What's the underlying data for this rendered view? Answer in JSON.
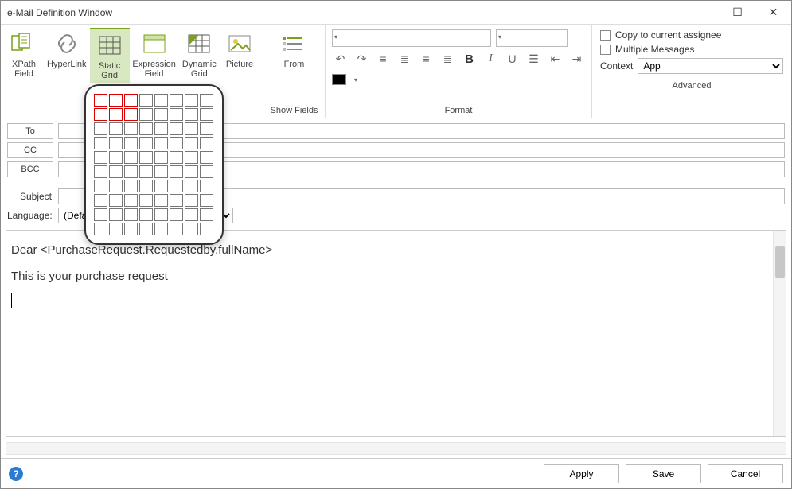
{
  "window": {
    "title": "e-Mail Definition Window"
  },
  "ribbon": {
    "group1": {
      "xpath_field": "XPath\nField",
      "hyperlink": "HyperLink",
      "static_grid": "Static\nGrid",
      "expression_field": "Expression\nField",
      "dynamic_grid": "Dynamic\nGrid",
      "picture": "Picture"
    },
    "show_fields": {
      "label": "Show Fields",
      "from": "From"
    },
    "format": {
      "label": "Format"
    },
    "advanced": {
      "label": "Advanced",
      "copy_assignee": "Copy to current assignee",
      "multiple_messages": "Multiple Messages",
      "context_label": "Context",
      "context_value": "App"
    }
  },
  "fields": {
    "to": "To",
    "cc": "CC",
    "bcc": "BCC",
    "subject": "Subject",
    "language": "Language:",
    "language_value": "(Default)"
  },
  "editor": {
    "line1": "Dear <PurchaseRequest.Requestedby.fullName>",
    "line2": "This is your purchase request"
  },
  "grid_popup": {
    "hint": "2x3",
    "rows": 10,
    "cols": 8,
    "sel_rows": 2,
    "sel_cols": 3
  },
  "footer": {
    "apply": "Apply",
    "save": "Save",
    "cancel": "Cancel"
  }
}
